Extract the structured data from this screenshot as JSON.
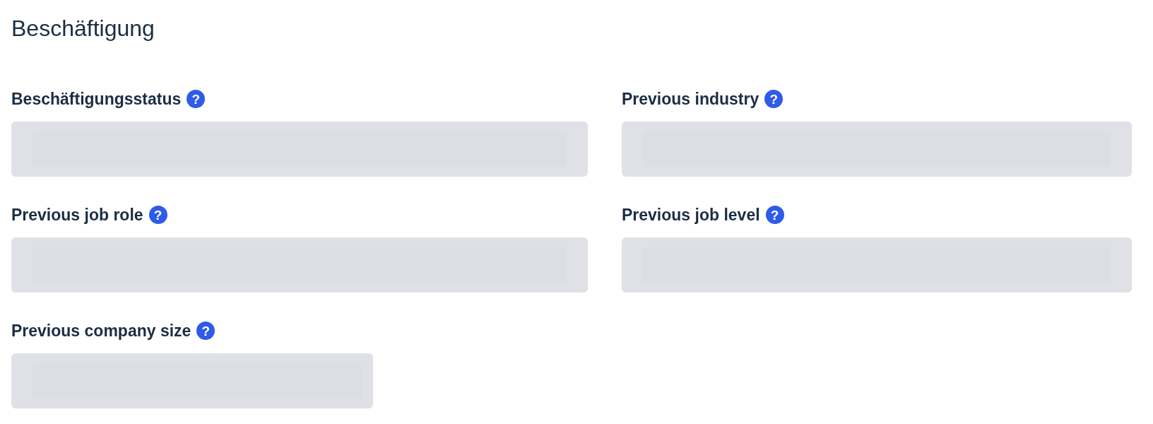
{
  "section_title": "Beschäftigung",
  "fields": [
    {
      "label": "Beschäftigungsstatus",
      "help": "?",
      "kind": "wide"
    },
    {
      "label": "Previous industry",
      "help": "?",
      "kind": "wide"
    },
    {
      "label": "Previous job role",
      "help": "?",
      "kind": "wide"
    },
    {
      "label": "Previous job level",
      "help": "?",
      "kind": "wide"
    },
    {
      "label": "Previous company size",
      "help": "?",
      "kind": "narrow"
    }
  ]
}
